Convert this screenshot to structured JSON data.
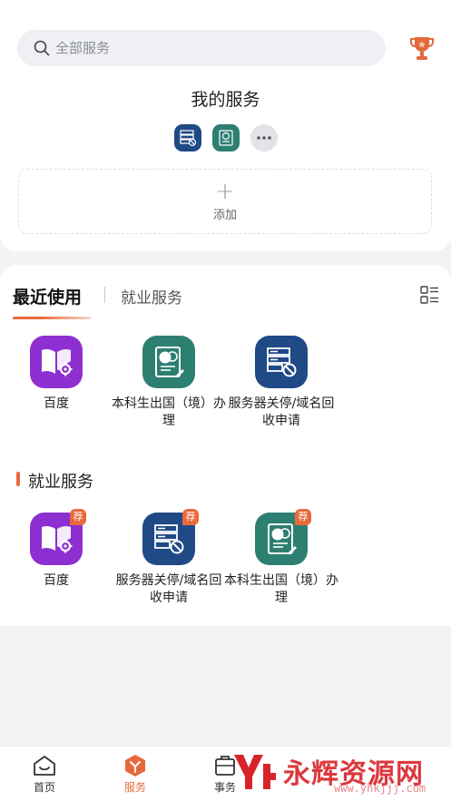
{
  "search": {
    "placeholder": "全部服务"
  },
  "my_services": {
    "title": "我的服务",
    "add_label": "添加",
    "add_plus": "+"
  },
  "tabs": {
    "recent": "最近使用",
    "jobs": "就业服务"
  },
  "recent_apps": [
    {
      "label": "百度",
      "icon": "book-gear-icon",
      "color": "#8d2fd1"
    },
    {
      "label": "本科生出国（境）办理",
      "icon": "passport-form-icon",
      "color": "#2d7f72"
    },
    {
      "label": "服务器关停/域名回收申请",
      "icon": "server-block-icon",
      "color": "#1f4a86"
    }
  ],
  "section": {
    "title": "就业服务"
  },
  "job_apps": [
    {
      "label": "百度",
      "badge": "荐",
      "icon": "book-gear-icon",
      "color": "#8d2fd1"
    },
    {
      "label": "服务器关停/域名回收申请",
      "badge": "荐",
      "icon": "server-block-icon",
      "color": "#1f4a86"
    },
    {
      "label": "本科生出国（境）办理",
      "badge": "荐",
      "icon": "passport-form-icon",
      "color": "#2d7f72"
    }
  ],
  "nav": [
    {
      "label": "首页",
      "icon": "home-icon"
    },
    {
      "label": "服务",
      "icon": "service-icon",
      "active": true
    },
    {
      "label": "事务",
      "icon": "affairs-icon"
    }
  ],
  "watermark": {
    "text": "永辉资源网",
    "url": "www.yhkjjj.com"
  },
  "colors": {
    "accent": "#e8693c",
    "navy": "#1f4a86",
    "teal": "#2d7f72",
    "purple": "#8d2fd1"
  }
}
